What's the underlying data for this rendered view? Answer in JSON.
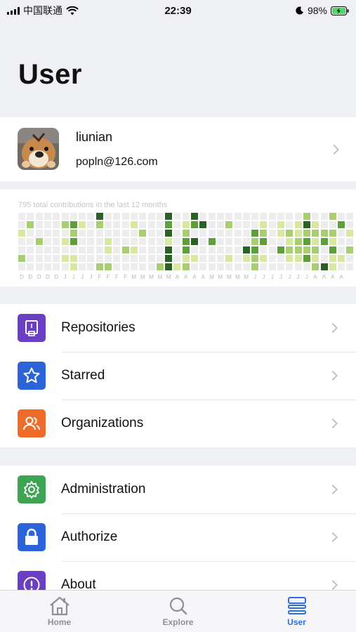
{
  "status_bar": {
    "carrier": "中国联通",
    "time": "22:39",
    "battery": "98%"
  },
  "header": {
    "title": "User"
  },
  "profile": {
    "username": "liunian",
    "email": "popln@126.com"
  },
  "contributions": {
    "caption": "795 total contributions in the last 12 months",
    "month_labels": [
      "D",
      "D",
      "D",
      "D",
      "D",
      "J",
      "J",
      "J",
      "J",
      "F",
      "F",
      "F",
      "F",
      "M",
      "M",
      "M",
      "M",
      "M",
      "A",
      "A",
      "A",
      "A",
      "M",
      "M",
      "M",
      "M",
      "M",
      "J",
      "J",
      "J",
      "J",
      "J",
      "J",
      "J",
      "A",
      "A",
      "A",
      "A"
    ],
    "colors": [
      "#ededed",
      "#d7e8a0",
      "#a7cf72",
      "#5e9e3c",
      "#2a6125"
    ],
    "weeks": [
      [
        0,
        0,
        1,
        0,
        0,
        2,
        0
      ],
      [
        0,
        2,
        0,
        0,
        0,
        0,
        0
      ],
      [
        0,
        0,
        0,
        2,
        0,
        0,
        0
      ],
      [
        0,
        0,
        0,
        0,
        0,
        0,
        0
      ],
      [
        0,
        0,
        0,
        0,
        0,
        0,
        0
      ],
      [
        0,
        2,
        0,
        1,
        0,
        1,
        0
      ],
      [
        0,
        3,
        2,
        3,
        0,
        1,
        1
      ],
      [
        0,
        1,
        0,
        0,
        0,
        0,
        0
      ],
      [
        0,
        0,
        0,
        0,
        0,
        0,
        0
      ],
      [
        4,
        2,
        0,
        0,
        0,
        0,
        2
      ],
      [
        0,
        0,
        0,
        1,
        1,
        0,
        2
      ],
      [
        0,
        0,
        0,
        0,
        0,
        0,
        0
      ],
      [
        0,
        0,
        0,
        0,
        2,
        0,
        0
      ],
      [
        0,
        1,
        0,
        0,
        1,
        0,
        0
      ],
      [
        0,
        0,
        2,
        0,
        0,
        0,
        0
      ],
      [
        0,
        0,
        0,
        0,
        0,
        0,
        0
      ],
      [
        0,
        0,
        0,
        0,
        0,
        0,
        2
      ],
      [
        4,
        3,
        4,
        1,
        4,
        4,
        4
      ],
      [
        0,
        0,
        0,
        0,
        0,
        0,
        1
      ],
      [
        0,
        1,
        2,
        3,
        3,
        1,
        2
      ],
      [
        4,
        3,
        0,
        4,
        0,
        1,
        0
      ],
      [
        0,
        4,
        0,
        0,
        0,
        0,
        0
      ],
      [
        0,
        0,
        0,
        3,
        0,
        0,
        0
      ],
      [
        0,
        0,
        0,
        0,
        0,
        0,
        0
      ],
      [
        0,
        2,
        0,
        0,
        0,
        1,
        0
      ],
      [
        0,
        0,
        0,
        0,
        0,
        0,
        0
      ],
      [
        0,
        0,
        0,
        0,
        4,
        1,
        0
      ],
      [
        0,
        0,
        3,
        2,
        3,
        2,
        2
      ],
      [
        0,
        1,
        2,
        3,
        0,
        1,
        0
      ],
      [
        0,
        0,
        0,
        0,
        0,
        0,
        0
      ],
      [
        0,
        1,
        1,
        0,
        3,
        0,
        0
      ],
      [
        0,
        0,
        2,
        1,
        2,
        1,
        0
      ],
      [
        0,
        1,
        1,
        2,
        2,
        1,
        0
      ],
      [
        2,
        4,
        2,
        3,
        2,
        3,
        0
      ],
      [
        0,
        1,
        2,
        1,
        2,
        1,
        2
      ],
      [
        0,
        0,
        2,
        3,
        0,
        0,
        4
      ],
      [
        2,
        0,
        2,
        1,
        3,
        1,
        1
      ],
      [
        0,
        3,
        0,
        0,
        0,
        1,
        0
      ],
      [
        0,
        0,
        1,
        0,
        2,
        0,
        0
      ]
    ]
  },
  "menu_group_1": [
    {
      "label": "Repositories",
      "icon": "book-icon",
      "color": "#6a3fc4"
    },
    {
      "label": "Starred",
      "icon": "star-icon",
      "color": "#2b63d8"
    },
    {
      "label": "Organizations",
      "icon": "people-icon",
      "color": "#ef6b2a"
    }
  ],
  "menu_group_2": [
    {
      "label": "Administration",
      "icon": "gear-icon",
      "color": "#3da453"
    },
    {
      "label": "Authorize",
      "icon": "lock-icon",
      "color": "#2b63d8"
    },
    {
      "label": "About",
      "icon": "info-icon",
      "color": "#6a3fc4"
    }
  ],
  "tab_bar": {
    "active": "User",
    "tabs": [
      {
        "label": "Home",
        "icon": "home-icon"
      },
      {
        "label": "Explore",
        "icon": "search-icon"
      },
      {
        "label": "User",
        "icon": "user-list-icon"
      }
    ]
  }
}
